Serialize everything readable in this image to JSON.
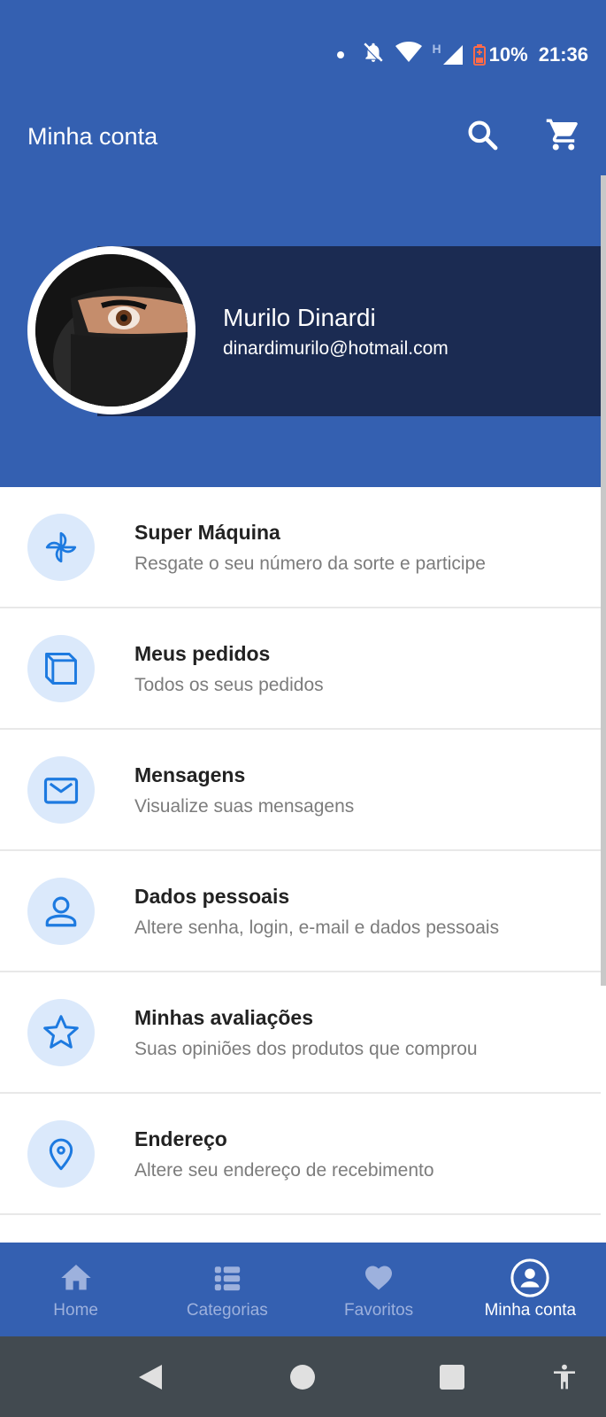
{
  "status_bar": {
    "battery": "10%",
    "time": "21:36",
    "network_type": "H"
  },
  "header": {
    "title": "Minha conta",
    "search_icon": "search-icon",
    "cart_icon": "cart-icon"
  },
  "profile": {
    "name": "Murilo Dinardi",
    "email": "dinardimurilo@hotmail.com"
  },
  "menu": [
    {
      "icon": "pinwheel-icon",
      "title": "Super Máquina",
      "subtitle": "Resgate o seu número da sorte e participe"
    },
    {
      "icon": "orders-box-icon",
      "title": "Meus pedidos",
      "subtitle": "Todos os seus pedidos"
    },
    {
      "icon": "envelope-icon",
      "title": "Mensagens",
      "subtitle": "Visualize suas mensagens"
    },
    {
      "icon": "person-icon",
      "title": "Dados pessoais",
      "subtitle": "Altere senha, login, e-mail e dados pessoais"
    },
    {
      "icon": "star-icon",
      "title": "Minhas avaliações",
      "subtitle": "Suas opiniões dos produtos que comprou"
    },
    {
      "icon": "location-pin-icon",
      "title": "Endereço",
      "subtitle": "Altere seu endereço de recebimento"
    }
  ],
  "bottom_nav": [
    {
      "label": "Home",
      "icon": "home-icon",
      "active": false
    },
    {
      "label": "Categorias",
      "icon": "categories-icon",
      "active": false
    },
    {
      "label": "Favoritos",
      "icon": "heart-icon",
      "active": false
    },
    {
      "label": "Minha conta",
      "icon": "account-circle-icon",
      "active": true
    }
  ],
  "colors": {
    "primary": "#3460b1",
    "band": "#1b2b52",
    "icon_bg": "#dbe9fb",
    "icon_fg": "#1d7ae0",
    "battery_low": "#ff6b4a"
  }
}
